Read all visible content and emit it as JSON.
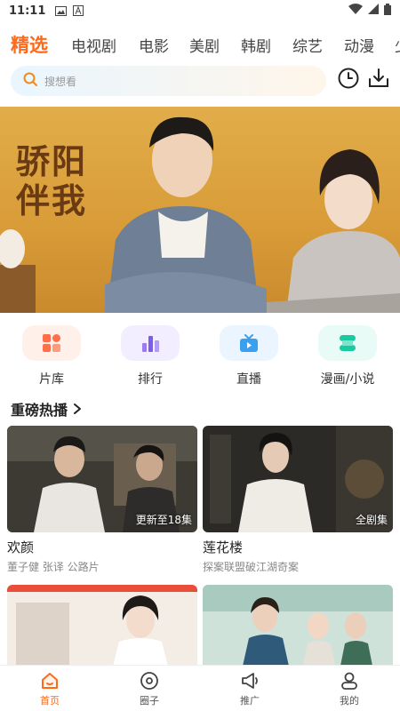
{
  "status": {
    "time": "11:11"
  },
  "topnav": {
    "tabs": [
      "精选",
      "电视剧",
      "电影",
      "美剧",
      "韩剧",
      "综艺",
      "动漫",
      "少"
    ],
    "active_color": "#ff6a1a"
  },
  "search": {
    "placeholder": "搜想看"
  },
  "banner": {
    "title_line1": "骄阳",
    "title_line2": "伴我"
  },
  "categories": [
    {
      "label": "片库",
      "icon": "library-icon"
    },
    {
      "label": "排行",
      "icon": "ranking-icon"
    },
    {
      "label": "直播",
      "icon": "live-tv-icon"
    },
    {
      "label": "漫画/小说",
      "icon": "comic-novel-icon"
    }
  ],
  "section": {
    "title": "重磅热播"
  },
  "cards": [
    {
      "name": "欢颜",
      "sub": "董子健 张译 公路片",
      "tag": "更新至18集"
    },
    {
      "name": "莲花楼",
      "sub": "探案联盟破江湖奇案",
      "tag": "全剧集"
    }
  ],
  "bottomnav": [
    {
      "label": "首页",
      "icon": "home-icon"
    },
    {
      "label": "圈子",
      "icon": "circle-icon"
    },
    {
      "label": "推广",
      "icon": "megaphone-icon"
    },
    {
      "label": "我的",
      "icon": "profile-icon"
    }
  ]
}
